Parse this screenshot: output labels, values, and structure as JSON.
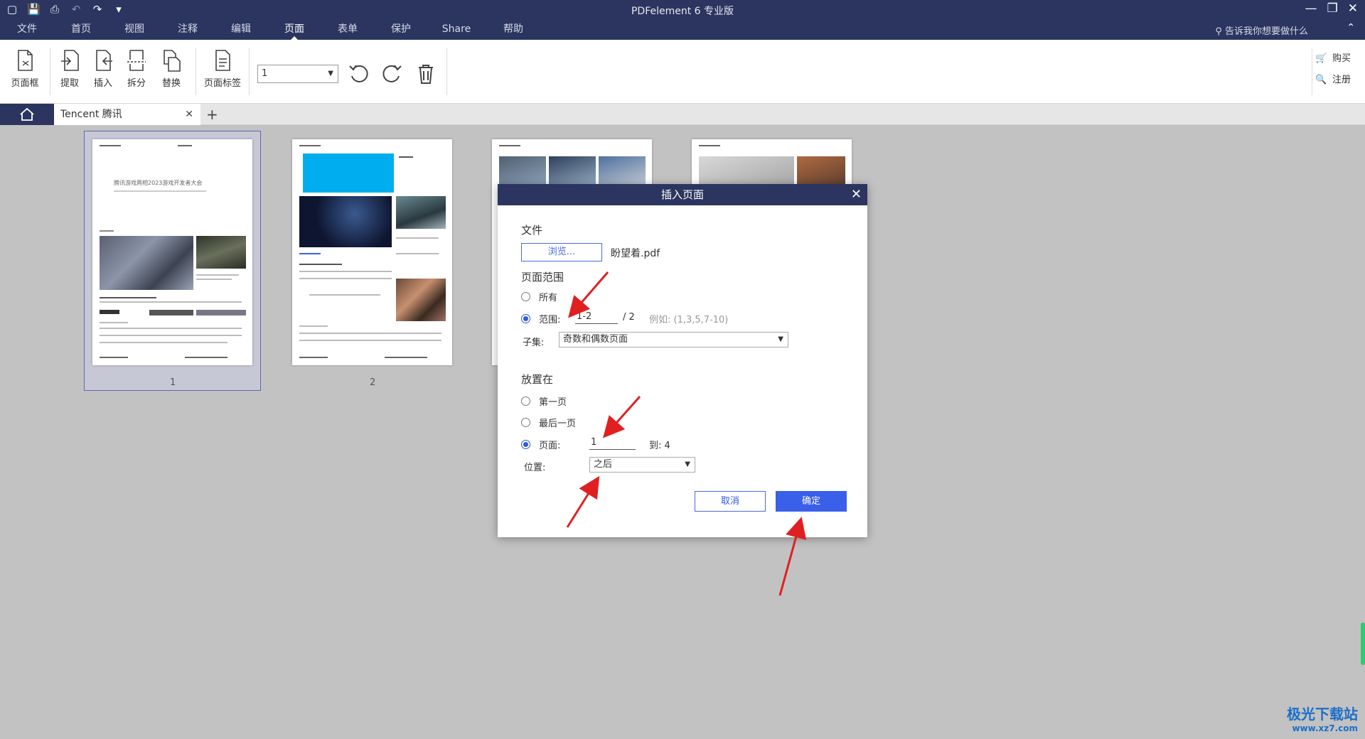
{
  "titlebar": {
    "app_title": "PDFelement 6 专业版",
    "quick_access": [
      "app-menu-icon",
      "save-icon",
      "print-icon",
      "undo-icon",
      "redo-icon",
      "customize-icon"
    ],
    "menu": [
      "文件",
      "首页",
      "视图",
      "注释",
      "编辑",
      "页面",
      "表单",
      "保护",
      "Share",
      "帮助"
    ],
    "active_menu": "页面",
    "tell_me": "告诉我你想要做什么"
  },
  "ribbon": {
    "buttons": [
      "页面框",
      "提取",
      "插入",
      "拆分",
      "替换",
      "页面标签"
    ],
    "page_select_value": "1",
    "buy": "购买",
    "register": "注册"
  },
  "tabs": {
    "doc_tab": "Tencent 腾讯",
    "add": "+"
  },
  "thumbnails": {
    "page1_label": "1",
    "page2_label": "2",
    "page1_heading": "腾讯游戏两相2023游戏开发者大会"
  },
  "dialog": {
    "title": "插入页面",
    "file_section": "文件",
    "browse": "浏览...",
    "filename": "盼望着.pdf",
    "range_section": "页面范围",
    "all": "所有",
    "range_label": "范围:",
    "range_value": "1-2",
    "range_total": "/  2",
    "example": "例如:  (1,3,5,7-10)",
    "subset_label": "子集:",
    "subset_value": "奇数和偶数页面",
    "place_section": "放置在",
    "first_page": "第一页",
    "last_page": "最后一页",
    "page_label": "页面:",
    "page_value": "1",
    "to_label": "到: 4",
    "position_label": "位置:",
    "position_value": "之后",
    "cancel": "取消",
    "ok": "确定"
  },
  "watermark": {
    "brand": "极光下载站",
    "url": "www.xz7.com"
  },
  "colors": {
    "titlebar": "#2b3560",
    "accent": "#3a5fe8",
    "arrow": "#e02020"
  }
}
